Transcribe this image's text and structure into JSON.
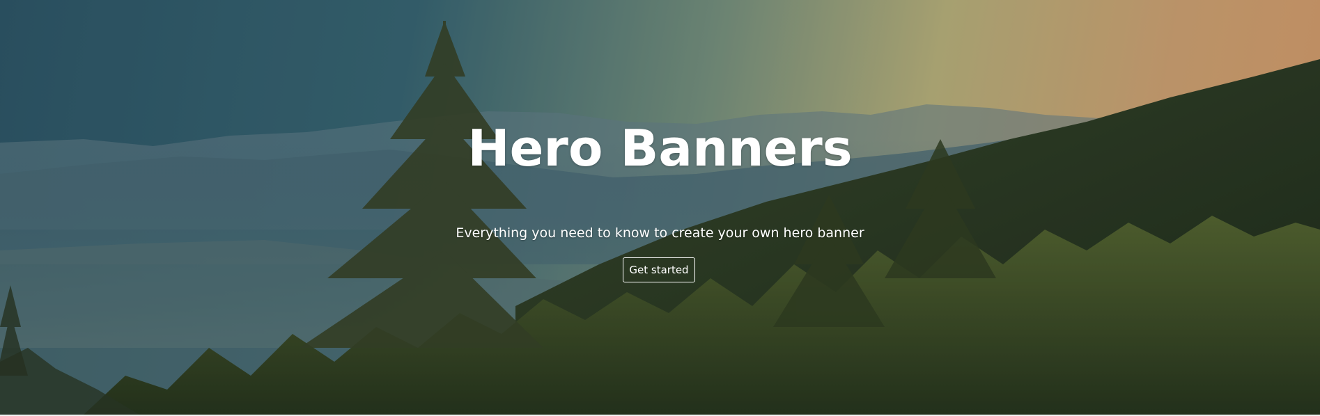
{
  "hero": {
    "title": "Hero Banners",
    "subtitle": "Everything you need to know to create your own hero banner",
    "cta_label": "Get started",
    "background_image": "mountain-forest-sunrise",
    "colors": {
      "text": "#ffffff",
      "sky_left": "#2f5a6c",
      "sky_right": "#e7a66f",
      "forest": "#2b3a1e"
    }
  }
}
